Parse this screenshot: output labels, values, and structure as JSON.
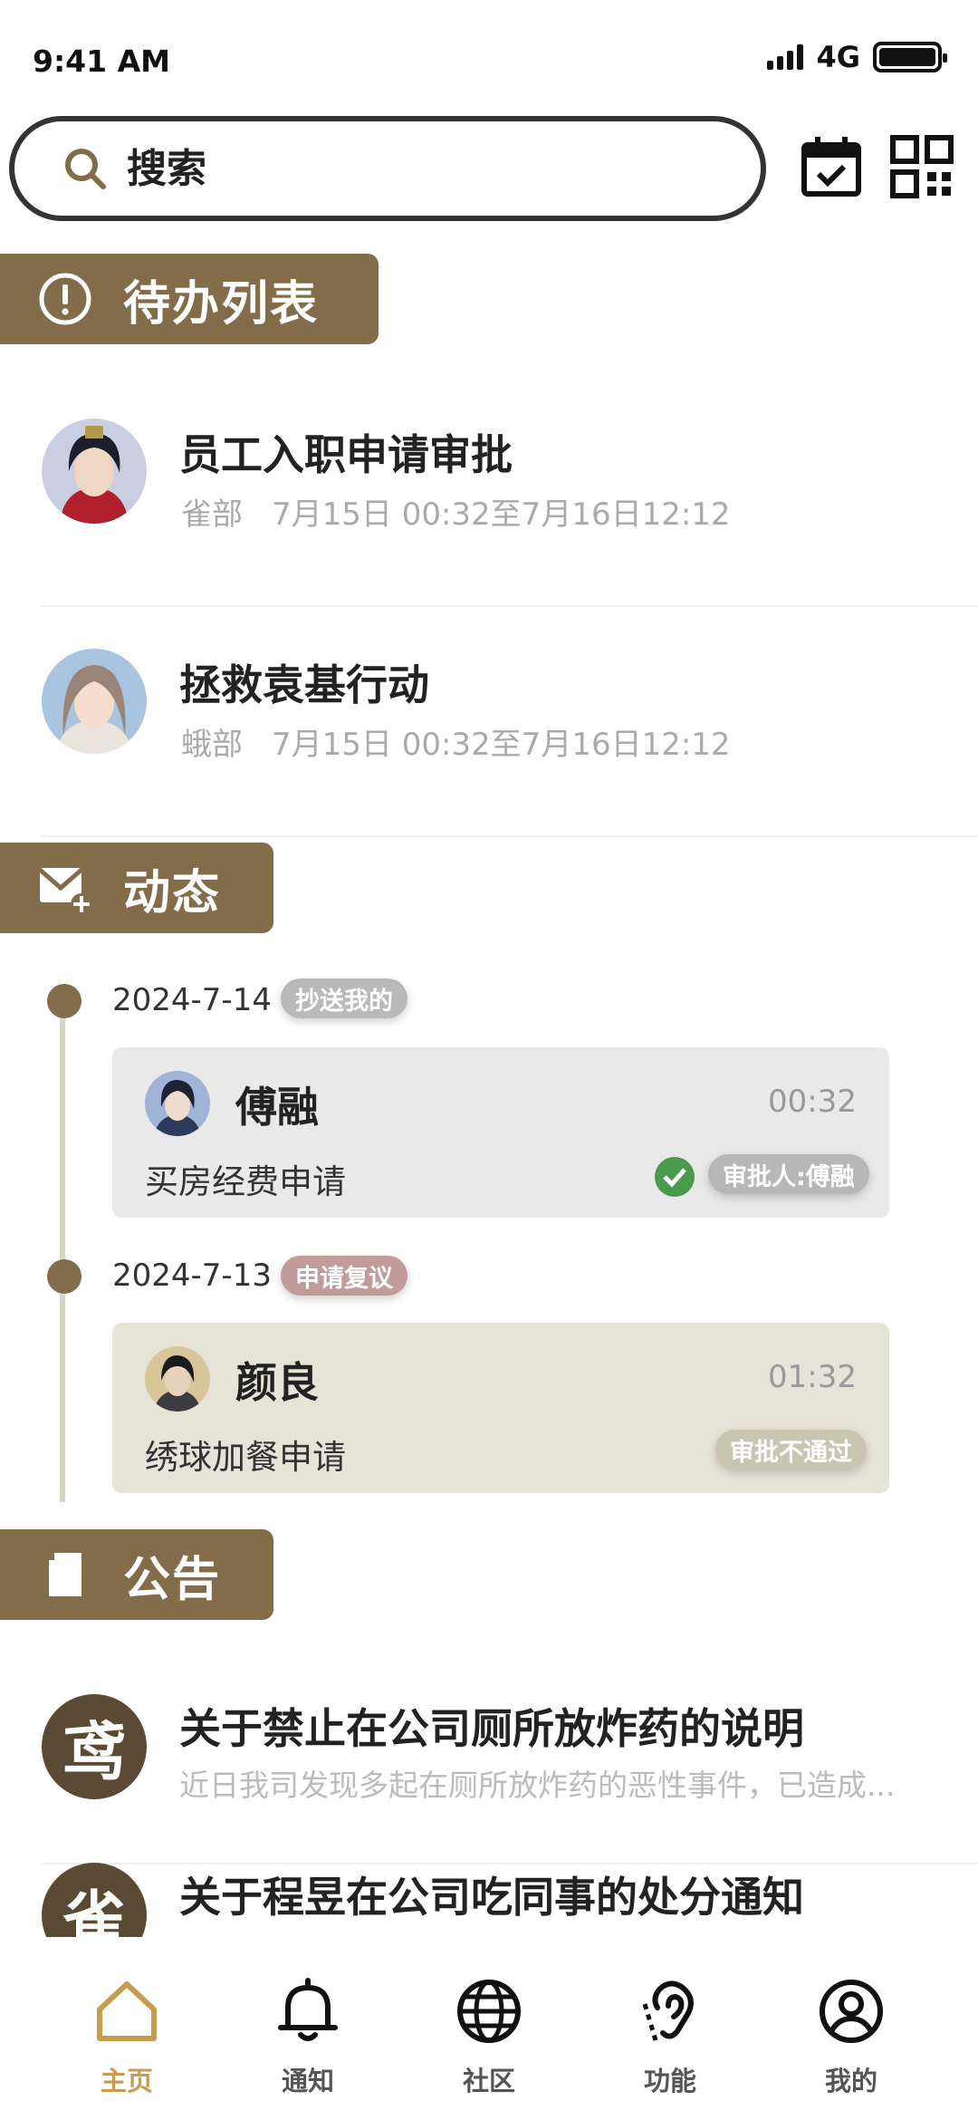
{
  "status_bar": {
    "time": "9:41 AM",
    "network": "4G"
  },
  "search": {
    "placeholder": "搜索"
  },
  "header_icons": [
    "calendar-check-icon",
    "qr-code-icon"
  ],
  "sections": {
    "todo": "待办列表",
    "activity": "动态",
    "notice": "公告"
  },
  "todos": [
    {
      "title": "员工入职申请审批",
      "dept": "雀部",
      "time": "7月15日 00:32至7月16日12:12"
    },
    {
      "title": "拯救袁基行动",
      "dept": "蛾部",
      "time": "7月15日 00:32至7月16日12:12"
    }
  ],
  "timeline": [
    {
      "date": "2024-7-14",
      "tag": "抄送我的",
      "tag_color": "#b9b9b9",
      "name": "傅融",
      "time": "00:32",
      "desc": "买房经费申请",
      "status": "审批人:傅融",
      "status_color": "#b7b7b7",
      "approved": true,
      "card_bg": "#e9e9e9"
    },
    {
      "date": "2024-7-13",
      "tag": "申请复议",
      "tag_color": "#c29b9b",
      "name": "颜良",
      "time": "01:32",
      "desc": "绣球加餐申请",
      "status": "审批不通过",
      "status_color": "#c9c5b3",
      "approved": false,
      "card_bg": "#e6e3d7"
    }
  ],
  "notices": [
    {
      "seal": "鸢",
      "title": "关于禁止在公司厕所放炸药的说明",
      "excerpt": "近日我司发现多起在厕所放炸药的恶性事件，已造成..."
    },
    {
      "seal": "雀",
      "title": "关于程昱在公司吃同事的处分通知",
      "excerpt": ""
    }
  ],
  "tabs": [
    {
      "label": "主页",
      "icon": "home-icon",
      "active": true
    },
    {
      "label": "通知",
      "icon": "bell-icon",
      "active": false
    },
    {
      "label": "社区",
      "icon": "globe-icon",
      "active": false
    },
    {
      "label": "功能",
      "icon": "hearing-icon",
      "active": false
    },
    {
      "label": "我的",
      "icon": "user-icon",
      "active": false
    }
  ],
  "colors": {
    "accent": "#826c4a",
    "tab_active": "#c79c4e",
    "approved": "#4a9a4e"
  }
}
